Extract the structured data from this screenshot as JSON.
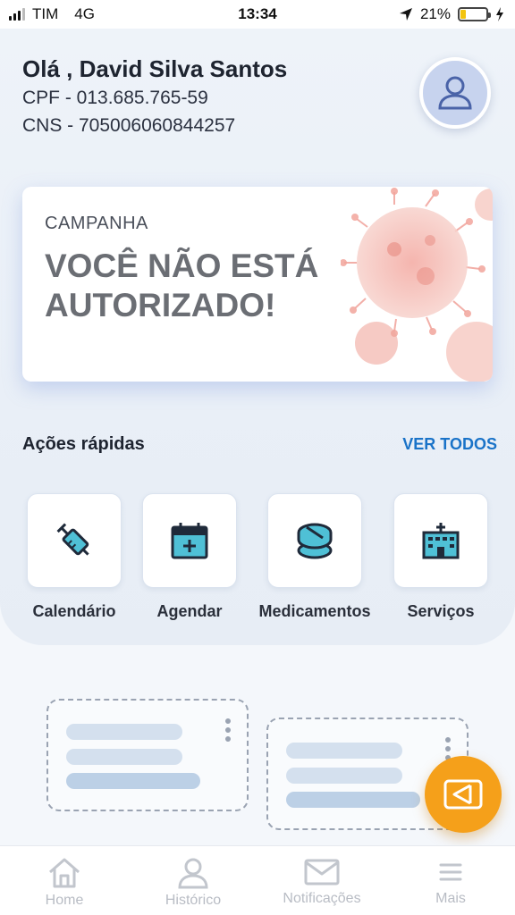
{
  "status_bar": {
    "carrier": "TIM",
    "network": "4G",
    "time": "13:34",
    "battery": "21%",
    "battery_level": 0.21
  },
  "user": {
    "greeting": "Olá , David Silva Santos",
    "cpf": "CPF - 013.685.765-59",
    "cns": "CNS - 705006060844257",
    "avatar_icon": "user-icon"
  },
  "campaign": {
    "label": "CAMPANHA",
    "title": "VOCÊ NÃO ESTÁ AUTORIZADO!",
    "art_icon": "virus-icon"
  },
  "quick_actions": {
    "title": "Ações rápidas",
    "see_all": "VER TODOS",
    "items": [
      {
        "label": "Calendário",
        "icon": "syringe-icon"
      },
      {
        "label": "Agendar",
        "icon": "calendar-plus-icon"
      },
      {
        "label": "Medicamentos",
        "icon": "pills-icon"
      },
      {
        "label": "Serviços",
        "icon": "hospital-icon"
      }
    ]
  },
  "fab": {
    "icon": "chat-icon"
  },
  "bottom_nav": [
    {
      "label": "Home",
      "icon": "home-icon"
    },
    {
      "label": "Histórico",
      "icon": "user-icon"
    },
    {
      "label": "Notificações",
      "icon": "mail-icon"
    },
    {
      "label": "Mais",
      "icon": "menu-icon"
    }
  ],
  "colors": {
    "accent_link": "#1a73c8",
    "fab": "#f5a01a",
    "icon_teal": "#4fc0d6",
    "icon_dark": "#1f2a3a"
  }
}
